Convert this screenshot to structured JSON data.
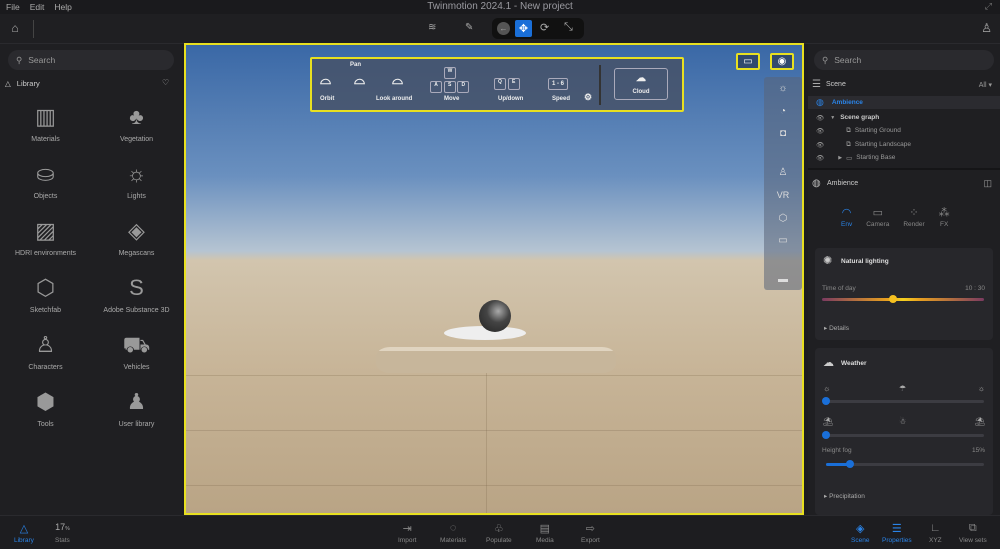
{
  "menu": {
    "items": [
      "File",
      "Edit",
      "Help"
    ],
    "title": "Twinmotion 2024.1 - New project"
  },
  "left": {
    "search_placeholder": "Search",
    "library_label": "Library",
    "items": [
      {
        "label": "Materials",
        "icon": "▥"
      },
      {
        "label": "Vegetation",
        "icon": "♣"
      },
      {
        "label": "Objects",
        "icon": "⛀"
      },
      {
        "label": "Lights",
        "icon": "☼"
      },
      {
        "label": "HDRI environments",
        "icon": "▨"
      },
      {
        "label": "Megascans",
        "icon": "◈"
      },
      {
        "label": "Sketchfab",
        "icon": "⬡"
      },
      {
        "label": "Adobe Substance 3D",
        "icon": "S"
      },
      {
        "label": "Characters",
        "icon": "♙"
      },
      {
        "label": "Vehicles",
        "icon": "⛟"
      },
      {
        "label": "Tools",
        "icon": "⬢"
      },
      {
        "label": "User library",
        "icon": "♟"
      }
    ]
  },
  "nav_help": {
    "orbit": "Orbit",
    "pan": "Pan",
    "look_around": "Look around",
    "move": "Move",
    "updown": "Up/down",
    "speed": "Speed",
    "speed_keys": "1 - 6",
    "cloud": "Cloud",
    "keys": {
      "w": "W",
      "a": "A",
      "s": "S",
      "d": "D",
      "q": "Q",
      "e": "E"
    }
  },
  "viewport_tools": {
    "vr": "VR"
  },
  "right": {
    "search_placeholder": "Search",
    "scene_label": "Scene",
    "filter": "All",
    "tree": {
      "ambience": "Ambience",
      "scene_graph": "Scene graph",
      "items": [
        "Starting Ground",
        "Starting Landscape",
        "Starting Base"
      ]
    },
    "panel_title": "Ambience",
    "tabs": [
      {
        "label": "Env",
        "icon": "◠"
      },
      {
        "label": "Camera",
        "icon": "▭"
      },
      {
        "label": "Render",
        "icon": "⁘"
      },
      {
        "label": "FX",
        "icon": "⁂"
      }
    ],
    "natural_lighting": {
      "title": "Natural lighting",
      "time_label": "Time of day",
      "time_value": "10 : 30",
      "time_fraction": 0.44,
      "details": "Details"
    },
    "weather": {
      "title": "Weather",
      "cloud_fraction": 0.0,
      "season_fraction": 0.0,
      "fog_label": "Height fog",
      "fog_value": "15%",
      "fog_fraction": 0.15,
      "precipitation": "Precipitation"
    }
  },
  "bottom": {
    "library": "Library",
    "stats_value": "17",
    "stats_unit": "%",
    "stats": "Stats",
    "center": [
      "Import",
      "Materials",
      "Populate",
      "Media",
      "Export"
    ],
    "right": [
      "Scene",
      "Properties",
      "XYZ",
      "View sets"
    ]
  },
  "colors": {
    "accent": "#2a84e8",
    "highlight": "#e8e020"
  }
}
